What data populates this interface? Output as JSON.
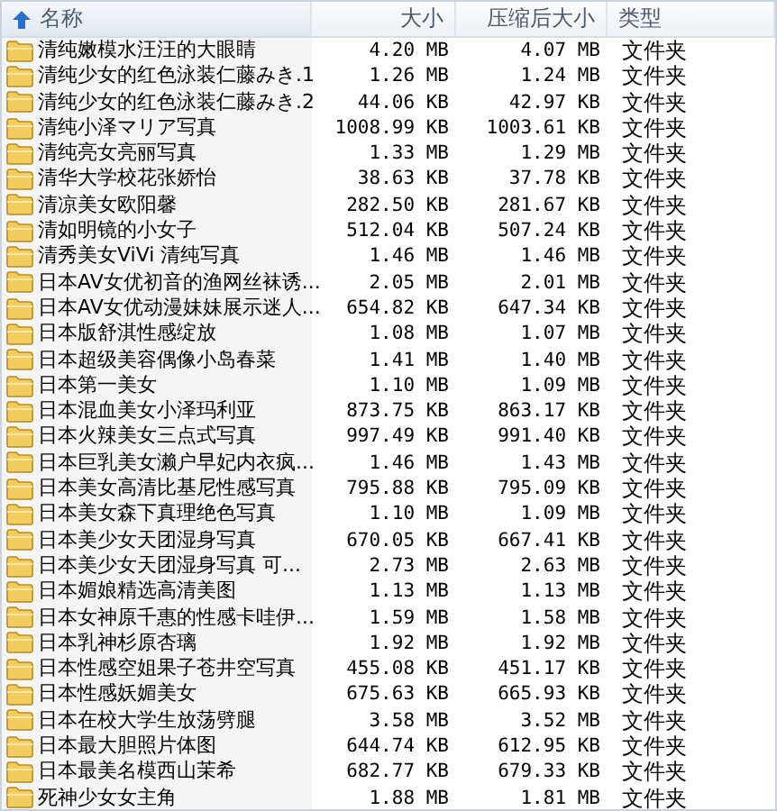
{
  "table": {
    "columns": [
      {
        "label": "名称",
        "sorted": true
      },
      {
        "label": "大小",
        "sorted": false
      },
      {
        "label": "压缩后大小",
        "sorted": false
      },
      {
        "label": "类型",
        "sorted": false
      }
    ],
    "rows": [
      {
        "name": "清纯嫩模水汪汪的大眼睛",
        "size": "4.20 MB",
        "packed": "4.07 MB",
        "type": "文件夹"
      },
      {
        "name": "清纯少女的红色泳装仁藤みき.1",
        "size": "1.26 MB",
        "packed": "1.24 MB",
        "type": "文件夹"
      },
      {
        "name": "清纯少女的红色泳装仁藤みき.2",
        "size": "44.06 KB",
        "packed": "42.97 KB",
        "type": "文件夹"
      },
      {
        "name": "清纯小泽マリア写真",
        "size": "1008.99 KB",
        "packed": "1003.61 KB",
        "type": "文件夹"
      },
      {
        "name": "清纯亮女亮丽写真",
        "size": "1.33 MB",
        "packed": "1.29 MB",
        "type": "文件夹"
      },
      {
        "name": "清华大学校花张娇怡",
        "size": "38.63 KB",
        "packed": "37.78 KB",
        "type": "文件夹"
      },
      {
        "name": "清凉美女欧阳馨",
        "size": "282.50 KB",
        "packed": "281.67 KB",
        "type": "文件夹"
      },
      {
        "name": "清如明镜的小女子",
        "size": "512.04 KB",
        "packed": "507.24 KB",
        "type": "文件夹"
      },
      {
        "name": "清秀美女ViVi 清纯写真",
        "size": "1.46 MB",
        "packed": "1.46 MB",
        "type": "文件夹"
      },
      {
        "name": "日本AV女优初音的渔网丝袜诱...",
        "size": "2.05 MB",
        "packed": "2.01 MB",
        "type": "文件夹"
      },
      {
        "name": "日本AV女优动漫妹妹展示迷人...",
        "size": "654.82 KB",
        "packed": "647.34 KB",
        "type": "文件夹"
      },
      {
        "name": "日本版舒淇性感绽放",
        "size": "1.08 MB",
        "packed": "1.07 MB",
        "type": "文件夹"
      },
      {
        "name": "日本超级美容偶像小岛春菜",
        "size": "1.41 MB",
        "packed": "1.40 MB",
        "type": "文件夹"
      },
      {
        "name": "日本第一美女",
        "size": "1.10 MB",
        "packed": "1.09 MB",
        "type": "文件夹"
      },
      {
        "name": "日本混血美女小泽玛利亚",
        "size": "873.75 KB",
        "packed": "863.17 KB",
        "type": "文件夹"
      },
      {
        "name": "日本火辣美女三点式写真",
        "size": "997.49 KB",
        "packed": "991.40 KB",
        "type": "文件夹"
      },
      {
        "name": "日本巨乳美女濑户早妃内衣疯...",
        "size": "1.46 MB",
        "packed": "1.43 MB",
        "type": "文件夹"
      },
      {
        "name": "日本美女高清比基尼性感写真",
        "size": "795.88 KB",
        "packed": "795.09 KB",
        "type": "文件夹"
      },
      {
        "name": "日本美女森下真理绝色写真",
        "size": "1.10 MB",
        "packed": "1.09 MB",
        "type": "文件夹"
      },
      {
        "name": "日本美少女天团湿身写真",
        "size": "670.05 KB",
        "packed": "667.41 KB",
        "type": "文件夹"
      },
      {
        "name": "日本美少女天团湿身写真 可...",
        "size": "2.73 MB",
        "packed": "2.63 MB",
        "type": "文件夹"
      },
      {
        "name": "日本媚娘精选高清美图",
        "size": "1.13 MB",
        "packed": "1.13 MB",
        "type": "文件夹"
      },
      {
        "name": "日本女神原千惠的性感卡哇伊...",
        "size": "1.59 MB",
        "packed": "1.58 MB",
        "type": "文件夹"
      },
      {
        "name": "日本乳神杉原杏璃",
        "size": "1.92 MB",
        "packed": "1.92 MB",
        "type": "文件夹"
      },
      {
        "name": "日本性感空姐果子苍井空写真",
        "size": "455.08 KB",
        "packed": "451.17 KB",
        "type": "文件夹"
      },
      {
        "name": "日本性感妖媚美女",
        "size": "675.63 KB",
        "packed": "665.93 KB",
        "type": "文件夹"
      },
      {
        "name": "日本在校大学生放荡劈腿",
        "size": "3.58 MB",
        "packed": "3.52 MB",
        "type": "文件夹"
      },
      {
        "name": "日本最大胆照片体图",
        "size": "644.74 KB",
        "packed": "612.95 KB",
        "type": "文件夹"
      },
      {
        "name": "日本最美名模西山茉希",
        "size": "682.77 KB",
        "packed": "679.33 KB",
        "type": "文件夹"
      },
      {
        "name": "死神少女女主角",
        "size": "1.88 MB",
        "packed": "1.81 MB",
        "type": "文件夹"
      }
    ]
  }
}
